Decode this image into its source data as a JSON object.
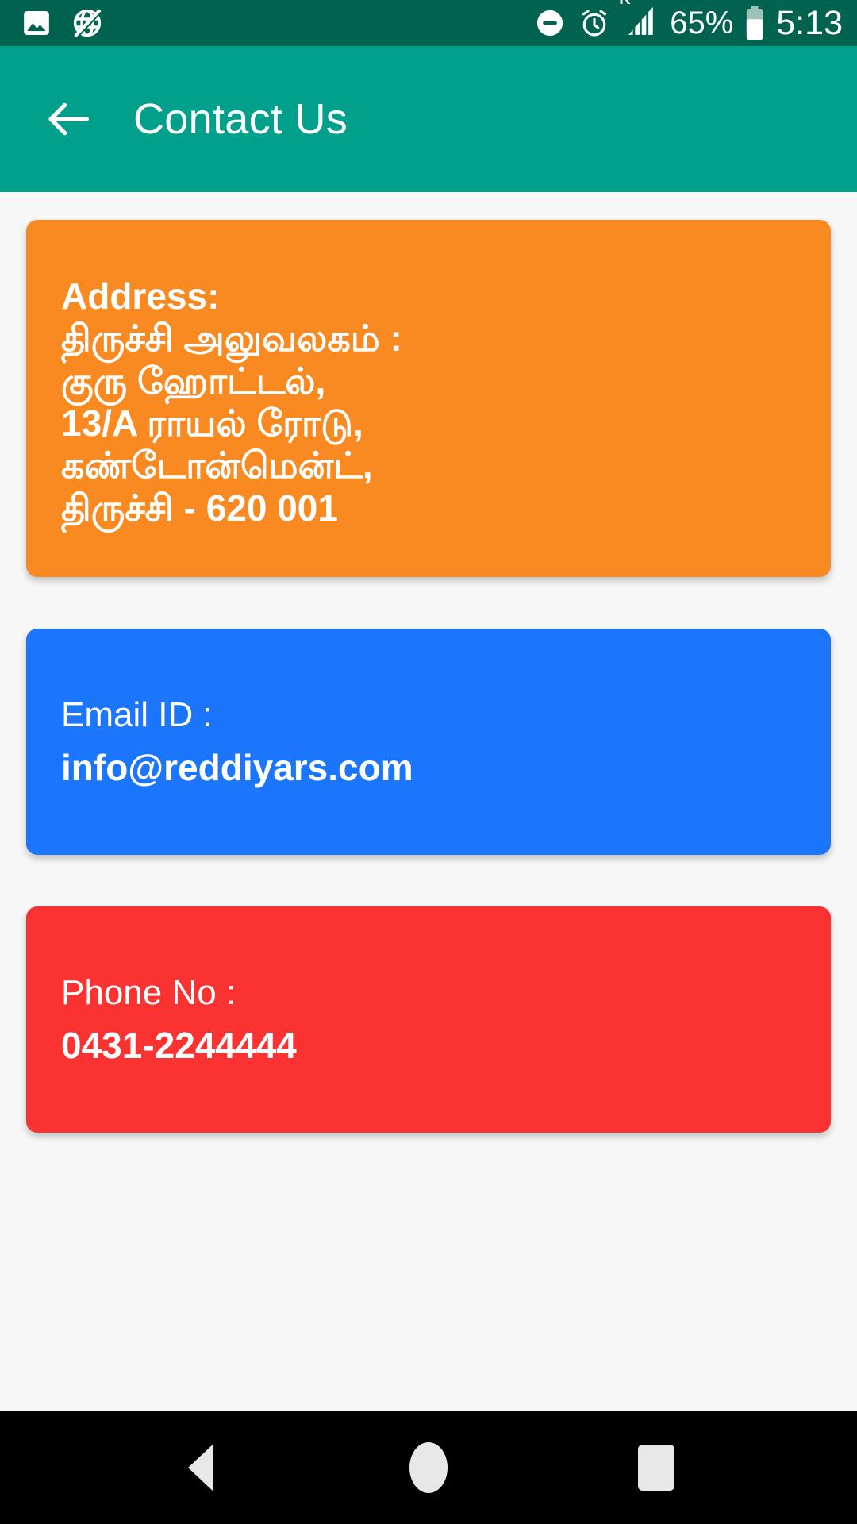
{
  "status_bar": {
    "background_color": "#00624F",
    "left_icons": [
      {
        "name": "photo-icon",
        "label": "image"
      },
      {
        "name": "globe-off-icon",
        "label": "no-internet"
      }
    ],
    "right_icons": [
      {
        "name": "do-not-disturb-icon",
        "label": "do-not-disturb"
      },
      {
        "name": "alarm-icon",
        "label": "alarm"
      },
      {
        "name": "roaming-signal-icon",
        "label": "roaming-signal"
      }
    ],
    "roaming_indicator": "R",
    "battery_percent": "65%",
    "clock": "5:13"
  },
  "app_bar": {
    "background_color": "#00A08B",
    "back_icon": "arrow-left-icon",
    "title": "Contact Us"
  },
  "cards": {
    "address": {
      "color": "#F98A22",
      "heading": "Address:",
      "lines": [
        "திருச்சி அலுவலகம் :",
        "குரு ஹோட்டல்,",
        "13/A ராயல் ரோடு,",
        "கண்டோன்மென்ட்,",
        "திருச்சி - 620 001"
      ]
    },
    "email": {
      "color": "#1B76FB",
      "label": "Email ID :",
      "value": "info@reddiyars.com"
    },
    "phone": {
      "color": "#FB3232",
      "label": "Phone No :",
      "value": "0431-2244444"
    }
  },
  "nav_bar": {
    "background_color": "#000000",
    "buttons": [
      {
        "name": "nav-back-button",
        "label": "Back"
      },
      {
        "name": "nav-home-button",
        "label": "Home"
      },
      {
        "name": "nav-recents-button",
        "label": "Recents"
      }
    ]
  }
}
